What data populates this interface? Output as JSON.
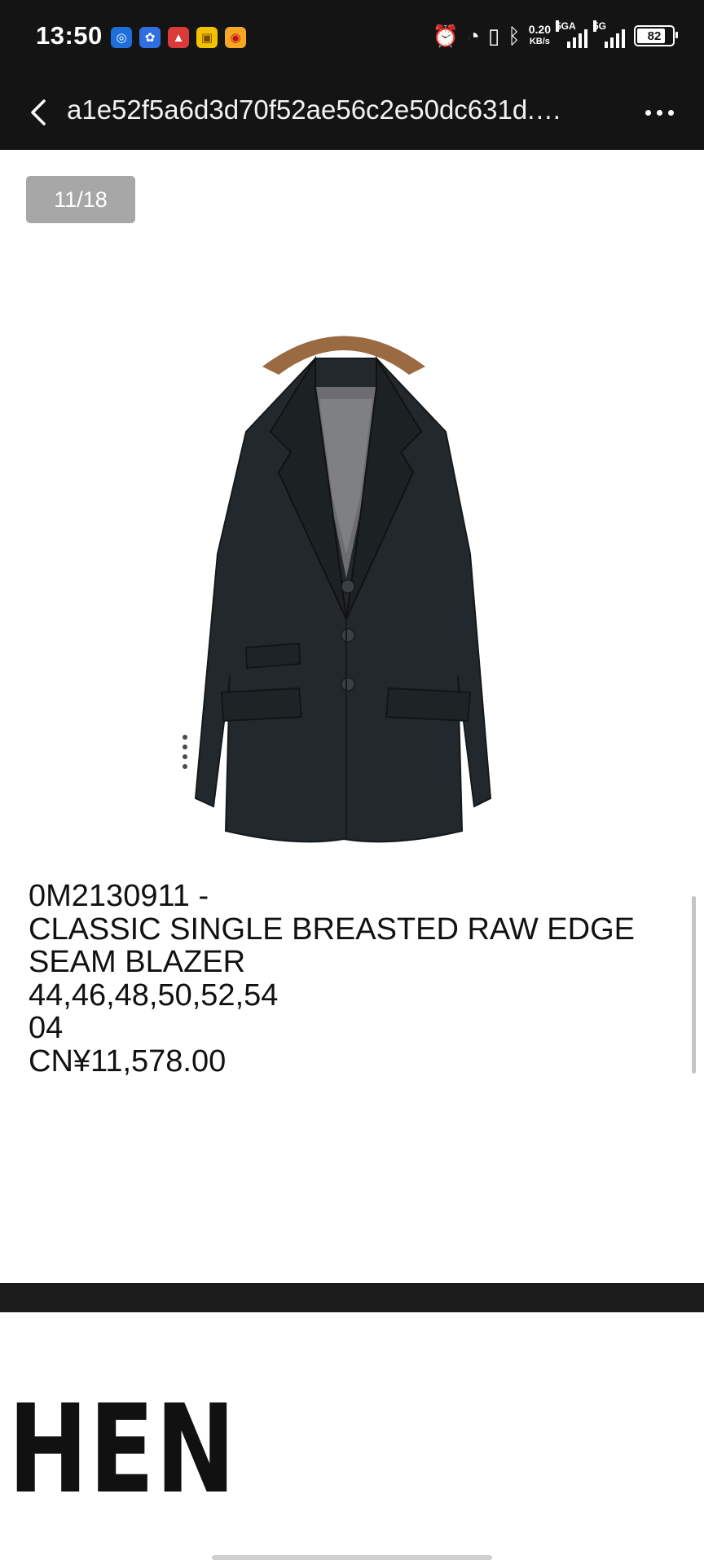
{
  "status_bar": {
    "time": "13:50",
    "net_speed_value": "0.20",
    "net_speed_unit": "KB/s",
    "sim1_label": "5GA",
    "sim2_label": "5G",
    "battery": "82",
    "battery_fraction": 0.82,
    "icons": [
      "alarm-icon",
      "speedometer-icon",
      "vibrate-icon",
      "bluetooth-icon"
    ],
    "app_icons": [
      {
        "name": "app-icon-1",
        "color": "#1e6fd9"
      },
      {
        "name": "app-icon-2",
        "color": "#2f6fe0"
      },
      {
        "name": "app-icon-3",
        "color": "#d93a3a"
      },
      {
        "name": "app-icon-4",
        "color": "#f2c200"
      },
      {
        "name": "weibo-icon",
        "color": "#f5a623"
      }
    ]
  },
  "app_bar": {
    "title": "a1e52f5a6d3d70f52ae56c2e50dc631d.…",
    "back_icon": "chevron-left-icon",
    "more_icon": "more-horizontal-icon"
  },
  "gallery": {
    "counter": "11/18"
  },
  "product": {
    "code_line": "0M2130911 -",
    "name_line1": "CLASSIC SINGLE BREASTED RAW EDGE",
    "name_line2": "SEAM BLAZER",
    "sizes": "44,46,48,50,52,54",
    "color_code": "04",
    "price": "CN¥11,578.00"
  },
  "footer": {
    "brand_text": "HEN"
  },
  "colors": {
    "bar_background": "#141414",
    "counter_background": "#a7a7a7",
    "text": "#111111"
  }
}
